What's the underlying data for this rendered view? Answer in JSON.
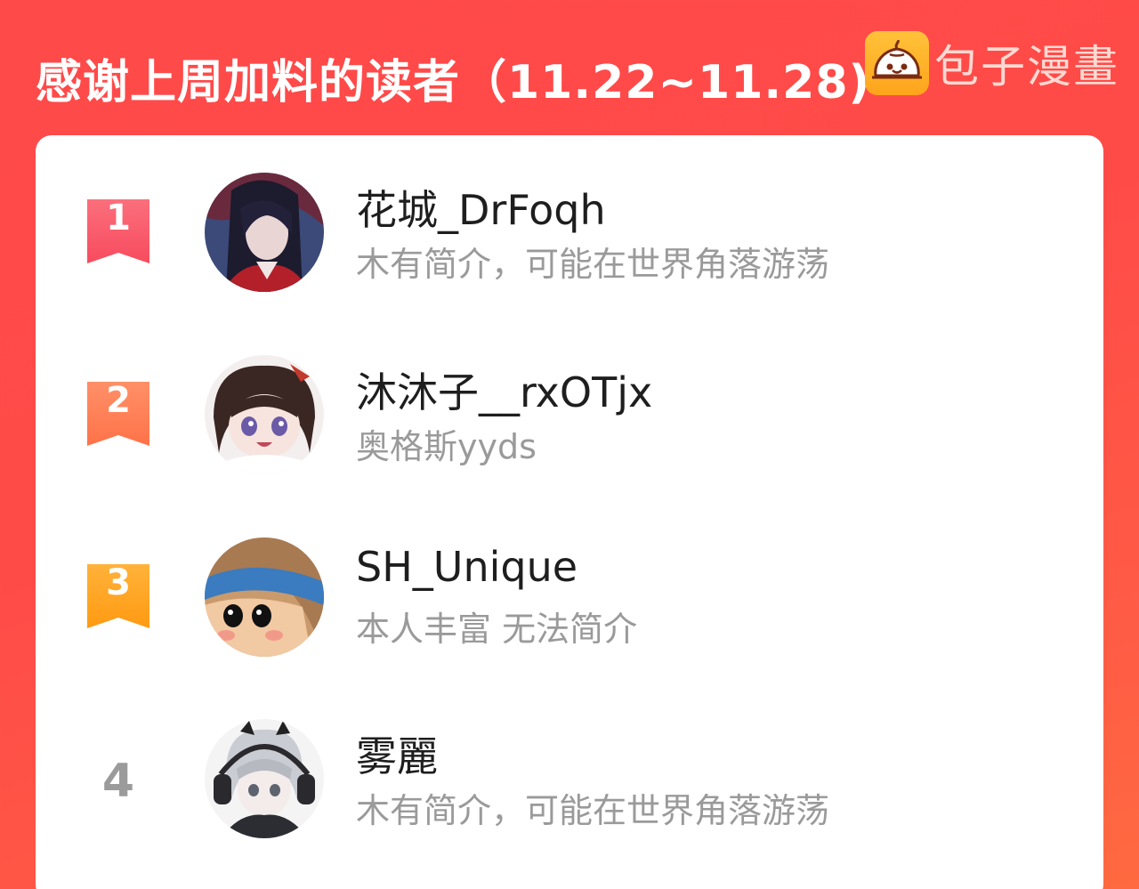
{
  "header": {
    "title": "感谢上周加料的读者（11.22~11.28)",
    "brand_name": "包子漫畫",
    "brand_icon": "bun-logo-icon"
  },
  "colors": {
    "background": "#ff4a4a",
    "rank1": "#f9556a",
    "rank2": "#ff7b4f",
    "rank3": "#ffa41c",
    "rank_plain": "#9b9b9b"
  },
  "readers": [
    {
      "rank": "1",
      "name": "花城_DrFoqh",
      "bio": "木有简介，可能在世界角落游荡"
    },
    {
      "rank": "2",
      "name": "沐沐子__rxOTjx",
      "bio": "奥格斯yyds"
    },
    {
      "rank": "3",
      "name": "SH_Unique",
      "bio": "本人丰富 无法简介"
    },
    {
      "rank": "4",
      "name": "雾麗",
      "bio": "木有简介，可能在世界角落游荡"
    }
  ]
}
